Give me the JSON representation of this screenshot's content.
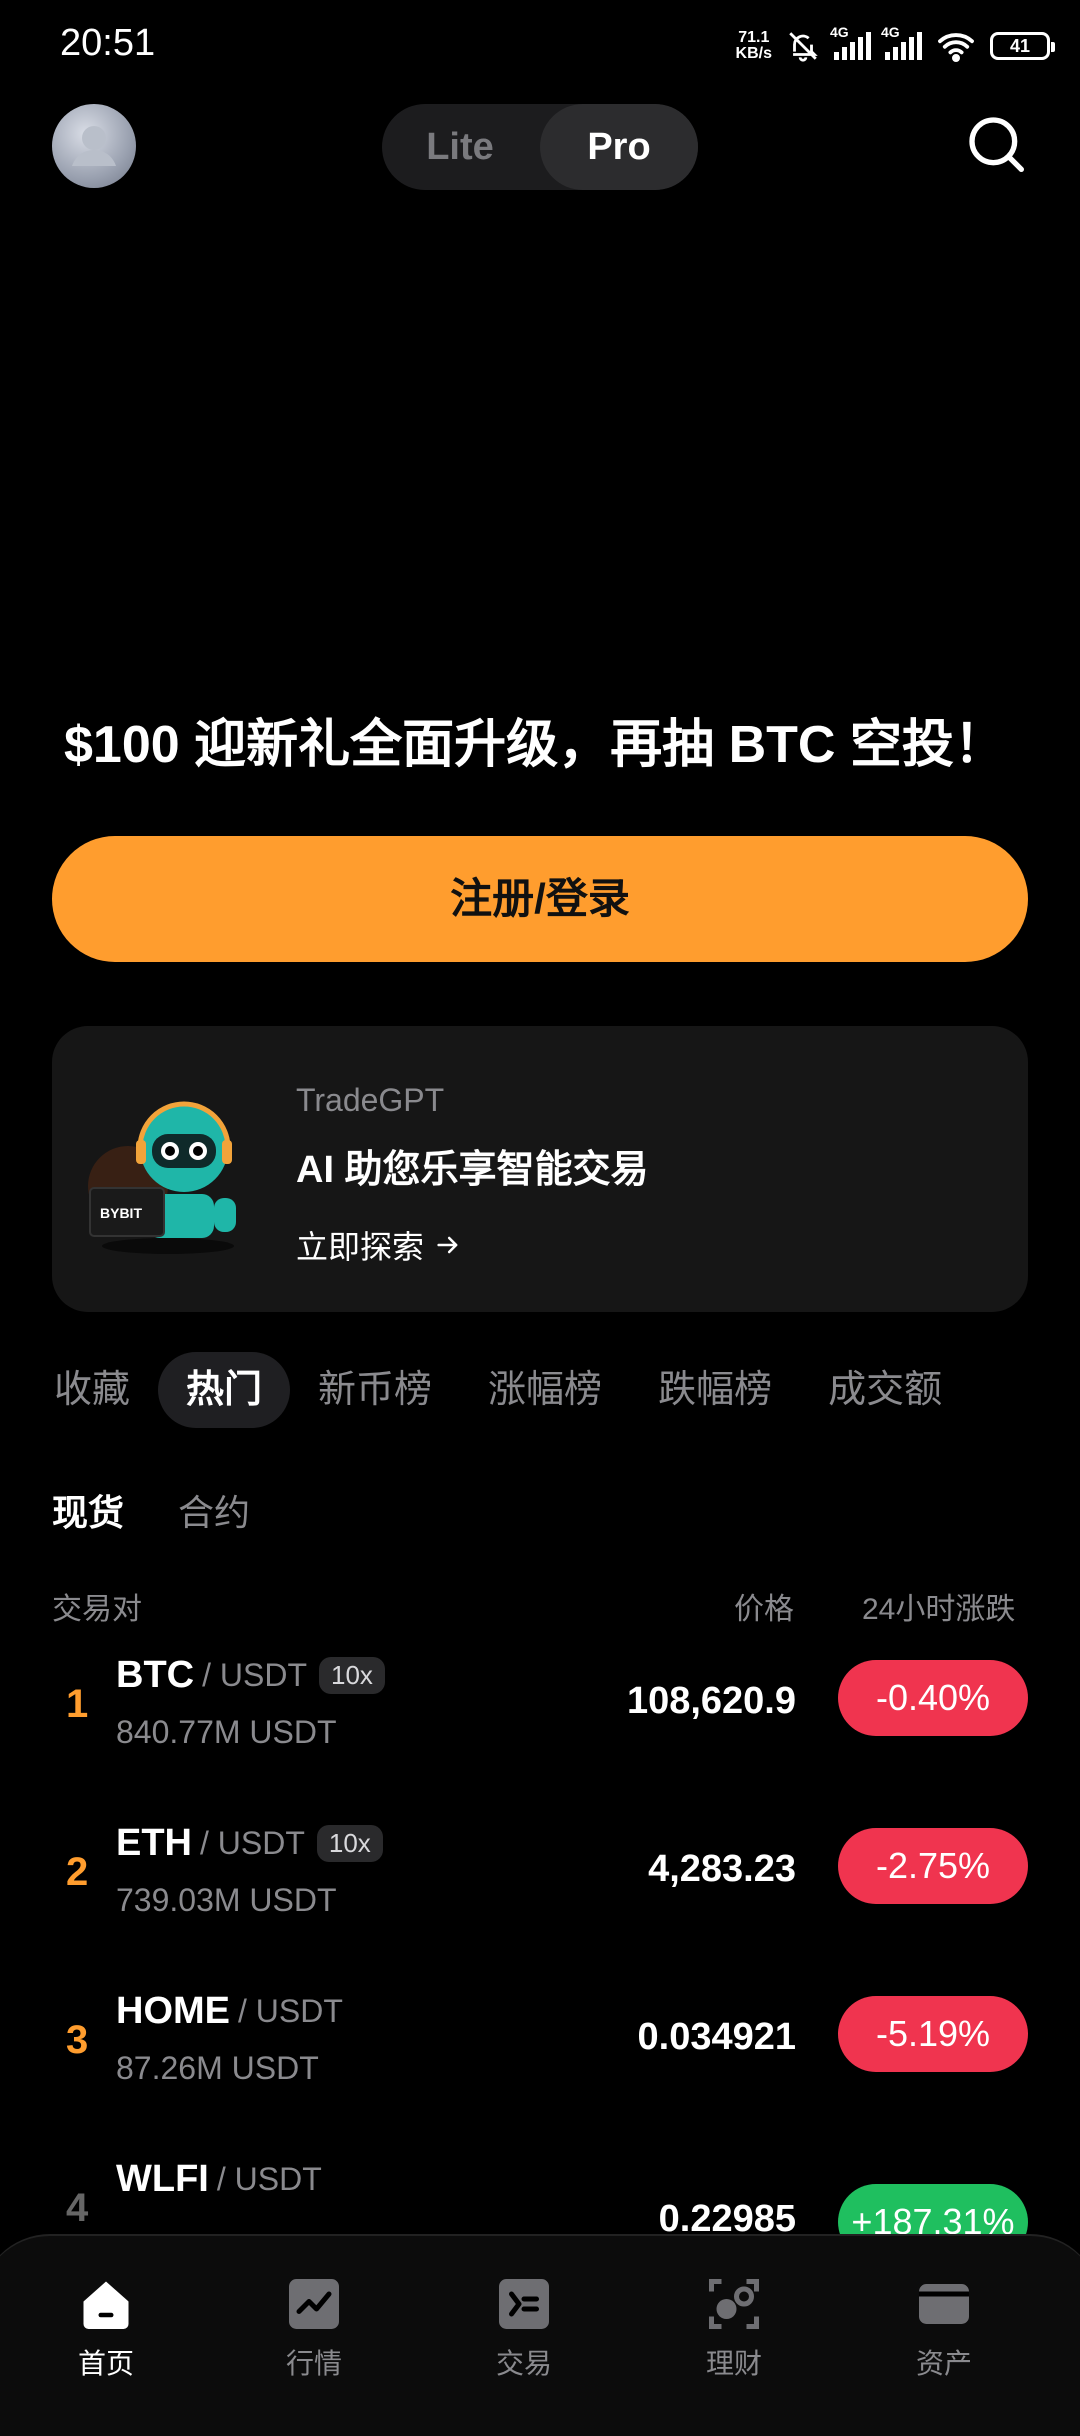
{
  "status_bar": {
    "time": "20:51",
    "net_speed_value": "71.1",
    "net_speed_unit": "KB/s",
    "sim1_tag": "4G",
    "sim2_tag": "4G",
    "battery": "41"
  },
  "header": {
    "mode_lite": "Lite",
    "mode_pro": "Pro",
    "active_mode": "Pro"
  },
  "promo": {
    "headline": "$100 迎新礼全面升级，再抽 BTC 空投！",
    "cta_label": "注册/登录",
    "accent_color": "#ff9d2e"
  },
  "ai_card": {
    "subtitle": "TradeGPT",
    "title": "AI 助您乐享智能交易",
    "link_label": "立即探索",
    "link_icon": "arrow-right-icon",
    "robot_screen_text": "BYBIT"
  },
  "category_tabs": [
    "收藏",
    "热门",
    "新币榜",
    "涨幅榜",
    "跌幅榜",
    "成交额"
  ],
  "category_active": "热门",
  "sub_tabs": [
    "现货",
    "合约"
  ],
  "sub_active": "现货",
  "table_header": {
    "pair": "交易对",
    "price": "价格",
    "change": "24小时涨跌"
  },
  "rows": [
    {
      "rank": "1",
      "base": "BTC",
      "quote": "/ USDT",
      "leverage": "10x",
      "volume": "840.77M USDT",
      "price": "108,620.9",
      "change": "-0.40%",
      "direction": "down"
    },
    {
      "rank": "2",
      "base": "ETH",
      "quote": "/ USDT",
      "leverage": "10x",
      "volume": "739.03M USDT",
      "price": "4,283.23",
      "change": "-2.75%",
      "direction": "down"
    },
    {
      "rank": "3",
      "base": "HOME",
      "quote": "/ USDT",
      "leverage": "",
      "volume": "87.26M USDT",
      "price": "0.034921",
      "change": "-5.19%",
      "direction": "down"
    },
    {
      "rank": "4",
      "base": "WLFI",
      "quote": "/ USDT",
      "leverage": "",
      "volume": "",
      "price": "0.22985",
      "change": "+187.31%",
      "direction": "up"
    }
  ],
  "colors": {
    "down": "#f0344f",
    "up": "#1fbf5f",
    "rank": "#ff9d2e"
  },
  "bottom_nav": [
    {
      "label": "首页",
      "icon": "home-icon",
      "active": true
    },
    {
      "label": "行情",
      "icon": "market-chart-icon",
      "active": false
    },
    {
      "label": "交易",
      "icon": "trade-icon",
      "active": false
    },
    {
      "label": "理财",
      "icon": "earn-icon",
      "active": false
    },
    {
      "label": "资产",
      "icon": "wallet-icon",
      "active": false
    }
  ]
}
